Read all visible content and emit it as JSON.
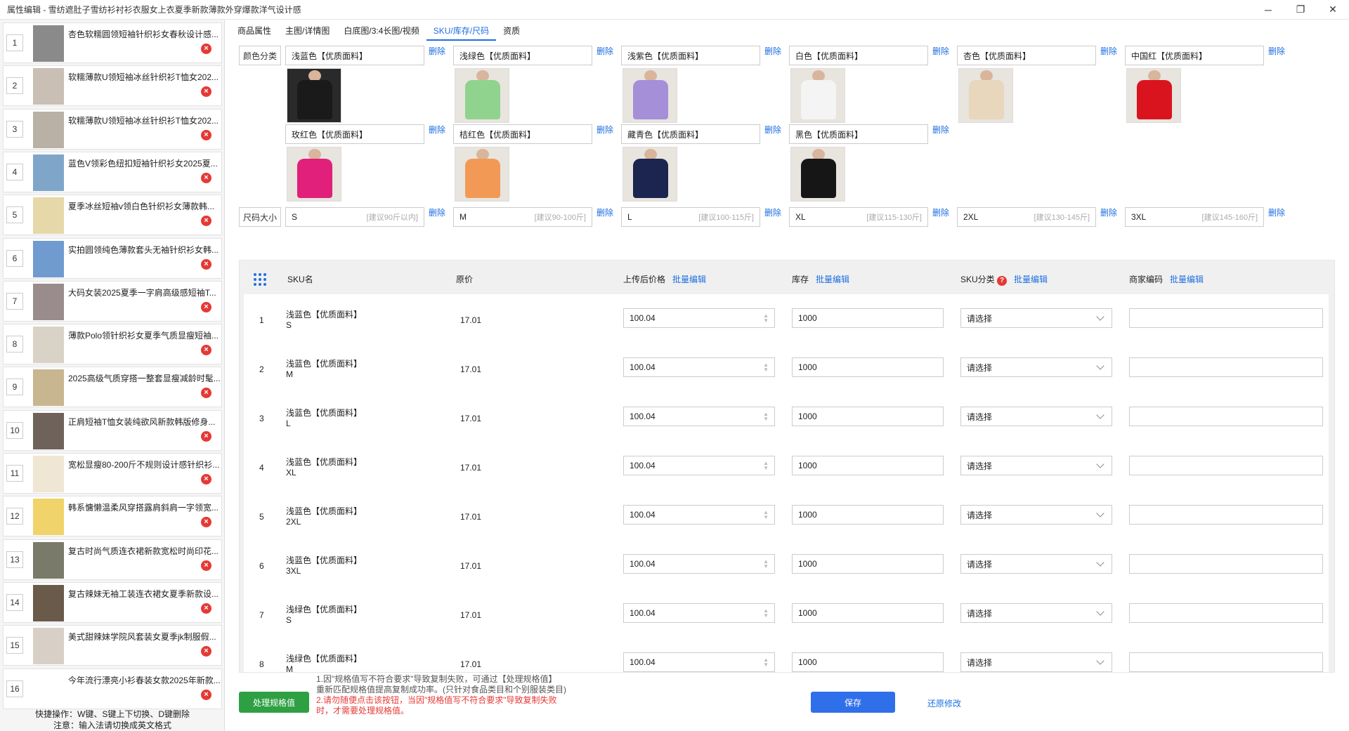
{
  "window": {
    "title": "属性编辑 - 雪纺遮肚子雪纺衫衬衫衣服女上衣夏季新款薄款外穿爆款洋气设计感",
    "controls": [
      "─",
      "❐",
      "✕"
    ]
  },
  "sidebar": {
    "items": [
      {
        "num": "1",
        "title": "杏色软糯圆领短袖针织衫女春秋设计感...",
        "thumb_color": "#8a8a8a"
      },
      {
        "num": "2",
        "title": "软糯薄款U领短袖冰丝针织衫T恤女202...",
        "thumb_color": "#c9bfb4"
      },
      {
        "num": "3",
        "title": "软糯薄款U领短袖冰丝针织衫T恤女202...",
        "thumb_color": "#b9b0a6"
      },
      {
        "num": "4",
        "title": "蓝色V领彩色纽扣短袖针织衫女2025夏...",
        "thumb_color": "#7fa6c9"
      },
      {
        "num": "5",
        "title": "夏季冰丝短袖v领白色针织衫女薄款韩...",
        "thumb_color": "#e6d8a8"
      },
      {
        "num": "6",
        "title": "实拍圆领纯色薄款套头无袖针织衫女韩...",
        "thumb_color": "#6f9bcf"
      },
      {
        "num": "7",
        "title": "大码女装2025夏季一字肩高级感短袖T...",
        "thumb_color": "#9a8c8c"
      },
      {
        "num": "8",
        "title": "薄款Polo领针织衫女夏季气质显瘦短袖...",
        "thumb_color": "#d9d2c6"
      },
      {
        "num": "9",
        "title": "2025高级气质穿搭一整套显瘦减龄时髦...",
        "thumb_color": "#c8b690"
      },
      {
        "num": "10",
        "title": "正肩短袖T恤女装纯欲风新款韩版修身...",
        "thumb_color": "#6e625a"
      },
      {
        "num": "11",
        "title": "宽松显瘦80-200斤不规则设计感针织衫...",
        "thumb_color": "#efe6d4"
      },
      {
        "num": "12",
        "title": "韩系慵懒温柔风穿搭露肩斜肩一字领宽...",
        "thumb_color": "#f0d36a"
      },
      {
        "num": "13",
        "title": "复古时尚气质连衣裙新款宽松时尚印花...",
        "thumb_color": "#7a7a6a"
      },
      {
        "num": "14",
        "title": "复古辣妹无袖工装连衣裙女夏季新款设...",
        "thumb_color": "#6a5a4a"
      },
      {
        "num": "15",
        "title": "美式甜辣妹学院风套装女夏季jk制服假...",
        "thumb_color": "#d8d0c6"
      },
      {
        "num": "16",
        "title": "今年流行漂亮小衫春装女款2025年新款...",
        "thumb_color": "#ffffff"
      }
    ],
    "hint_line1": "快捷操作：W键、S键上下切换、D键删除",
    "hint_line2": "注意：输入法请切换成英文格式"
  },
  "tabs": [
    "商品属性",
    "主图/详情图",
    "白底图/3:4长图/视频",
    "SKU/库存/尺码",
    "资质"
  ],
  "active_tab": 3,
  "spec": {
    "color_label": "颜色分类",
    "size_label": "尺码大小",
    "delete_label": "删除",
    "colors": [
      {
        "name": "浅蓝色【优质面料】",
        "shirt": "#1a1a1a"
      },
      {
        "name": "浅绿色【优质面料】",
        "shirt": "#8fd38f"
      },
      {
        "name": "浅紫色【优质面料】",
        "shirt": "#a48fd8"
      },
      {
        "name": "白色【优质面料】",
        "shirt": "#f4f4f4"
      },
      {
        "name": "杏色【优质面料】",
        "shirt": "#e8d6bd"
      },
      {
        "name": "中国红【优质面料】",
        "shirt": "#d9141e"
      },
      {
        "name": "玫红色【优质面料】",
        "shirt": "#e0207a"
      },
      {
        "name": "桔红色【优质面料】",
        "shirt": "#f29a55"
      },
      {
        "name": "藏青色【优质面料】",
        "shirt": "#1c2450"
      },
      {
        "name": "黑色【优质面料】",
        "shirt": "#161616"
      }
    ],
    "sizes": [
      {
        "name": "S",
        "hint": "[建议90斤以内]"
      },
      {
        "name": "M",
        "hint": "[建议90-100斤]"
      },
      {
        "name": "L",
        "hint": "[建议100-115斤]"
      },
      {
        "name": "XL",
        "hint": "[建议115-130斤]"
      },
      {
        "name": "2XL",
        "hint": "[建议130-145斤]"
      },
      {
        "name": "3XL",
        "hint": "[建议145-160斤]"
      }
    ]
  },
  "table": {
    "headers": {
      "sku_name": "SKU名",
      "orig_price": "原价",
      "upload_price": "上传后价格",
      "stock": "库存",
      "sku_category": "SKU分类",
      "merchant_code": "商家编码",
      "batch_edit": "批量编辑",
      "question_mark": "?"
    },
    "select_placeholder": "请选择",
    "rows": [
      {
        "idx": "1",
        "color": "浅蓝色【优质面料】",
        "size": "S",
        "orig": "17.01",
        "price": "100.04",
        "stock": "1000"
      },
      {
        "idx": "2",
        "color": "浅蓝色【优质面料】",
        "size": "M",
        "orig": "17.01",
        "price": "100.04",
        "stock": "1000"
      },
      {
        "idx": "3",
        "color": "浅蓝色【优质面料】",
        "size": "L",
        "orig": "17.01",
        "price": "100.04",
        "stock": "1000"
      },
      {
        "idx": "4",
        "color": "浅蓝色【优质面料】",
        "size": "XL",
        "orig": "17.01",
        "price": "100.04",
        "stock": "1000"
      },
      {
        "idx": "5",
        "color": "浅蓝色【优质面料】",
        "size": "2XL",
        "orig": "17.01",
        "price": "100.04",
        "stock": "1000"
      },
      {
        "idx": "6",
        "color": "浅蓝色【优质面料】",
        "size": "3XL",
        "orig": "17.01",
        "price": "100.04",
        "stock": "1000"
      },
      {
        "idx": "7",
        "color": "浅绿色【优质面料】",
        "size": "S",
        "orig": "17.01",
        "price": "100.04",
        "stock": "1000"
      },
      {
        "idx": "8",
        "color": "浅绿色【优质面料】",
        "size": "M",
        "orig": "17.01",
        "price": "100.04",
        "stock": "1000"
      }
    ]
  },
  "footer": {
    "process_button": "处理规格值",
    "note1": "1.因\"规格值写不符合要求\"导致复制失败，可通过【处理规格值】",
    "note2": "重新匹配规格值提高复制成功率。(只针对食品类目和个别服装类目)",
    "note3": "2.请勿随便点击该按钮，当因\"规格值写不符合要求\"导致复制失败",
    "note4": "时，才需要处理规格值。",
    "save_button": "保存",
    "restore_link": "还原修改"
  },
  "colors": {
    "accent": "#1e6fe0",
    "save": "#2f6fea",
    "process": "#2ea043",
    "danger": "#e53935"
  }
}
